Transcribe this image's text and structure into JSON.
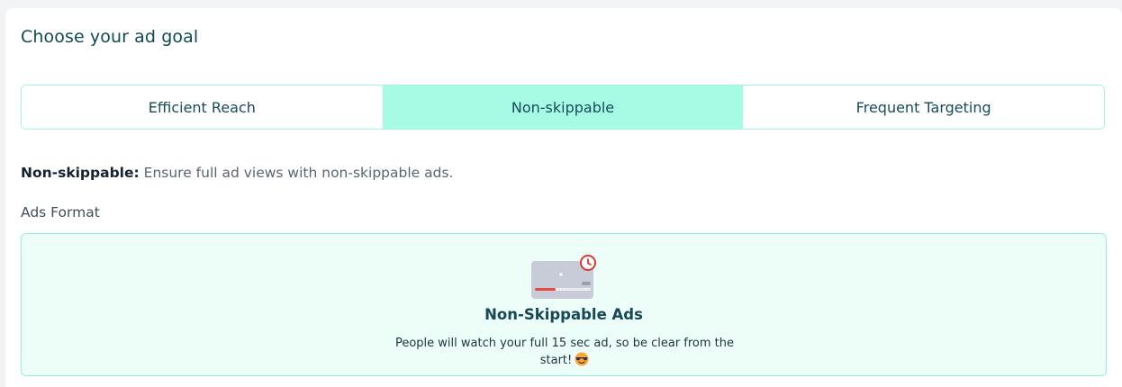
{
  "header": {
    "title": "Choose your ad goal"
  },
  "goal_tabs": [
    {
      "label": "Efficient Reach",
      "selected": false
    },
    {
      "label": "Non-skippable",
      "selected": true
    },
    {
      "label": "Frequent Targeting",
      "selected": false
    }
  ],
  "selected_description": {
    "name": "Non-skippable:",
    "text": " Ensure full ad views with non-skippable ads."
  },
  "ads_format": {
    "section_label": "Ads Format",
    "option": {
      "icon": "non-skippable-video-icon",
      "title": "Non-Skippable Ads",
      "description": "People will watch your full 15 sec ad, so be clear from the start!",
      "emoji": "cool-face-emoji"
    }
  },
  "colors": {
    "accent": "#a6fbe4",
    "accent_border": "#8ff2d3",
    "primary_text": "#0f4a52"
  }
}
